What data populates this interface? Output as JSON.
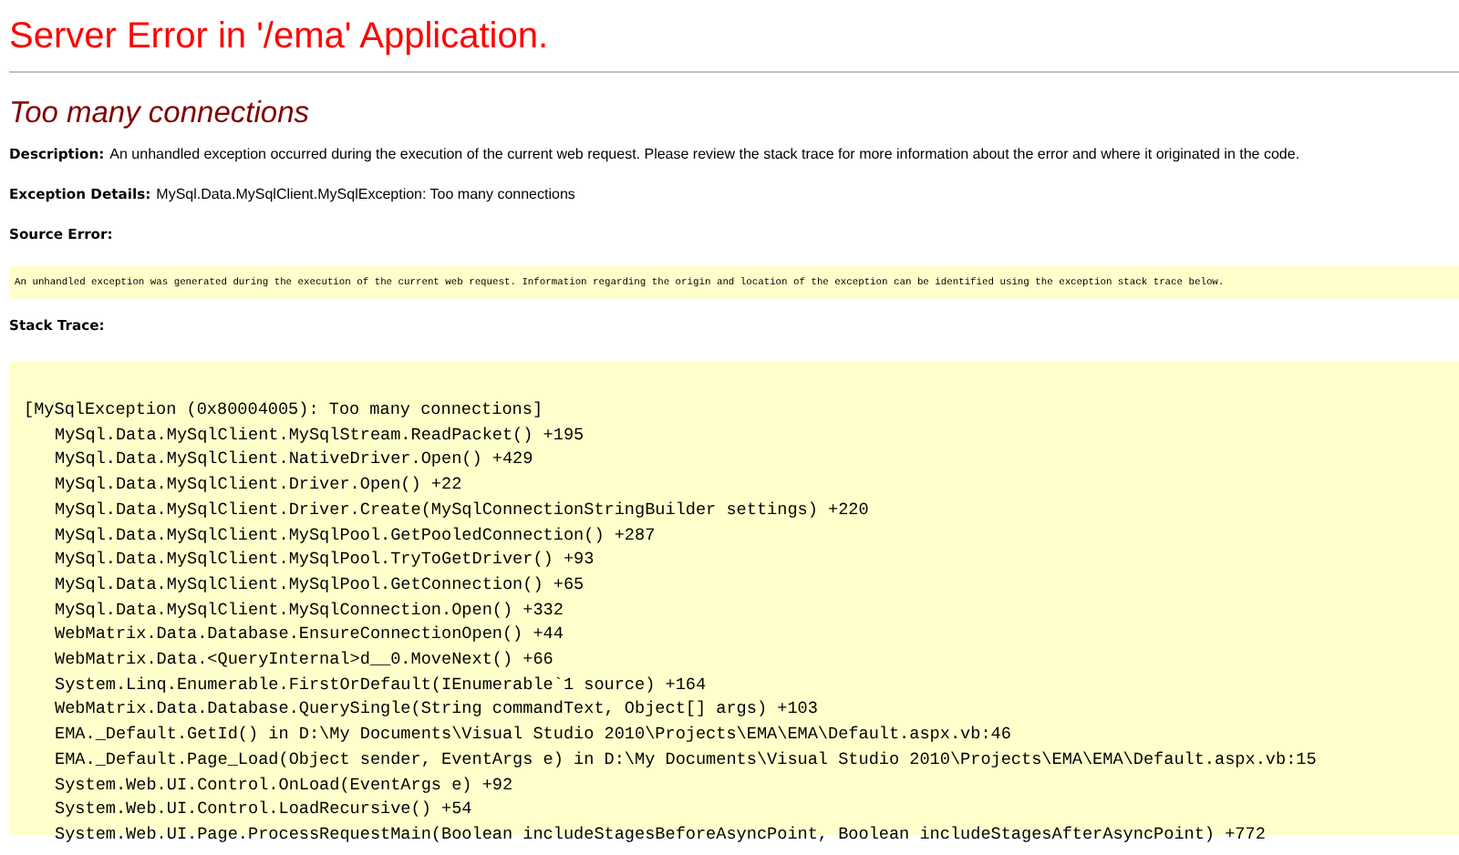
{
  "title": "Server Error in '/ema' Application.",
  "error_message": "Too many connections",
  "description": {
    "label": "Description:",
    "text": "An unhandled exception occurred during the execution of the current web request. Please review the stack trace for more information about the error and where it originated in the code."
  },
  "exception_details": {
    "label": "Exception Details:",
    "text": "MySql.Data.MySqlClient.MySqlException: Too many connections"
  },
  "source_error": {
    "label": "Source Error:",
    "text": "An unhandled exception was generated during the execution of the current web request. Information regarding the origin and location of the exception can be identified using the exception stack trace below."
  },
  "stack_trace": {
    "label": "Stack Trace:",
    "exception": "[MySqlException (0x80004005): Too many connections]",
    "frames": [
      "MySql.Data.MySqlClient.MySqlStream.ReadPacket() +195",
      "MySql.Data.MySqlClient.NativeDriver.Open() +429",
      "MySql.Data.MySqlClient.Driver.Open() +22",
      "MySql.Data.MySqlClient.Driver.Create(MySqlConnectionStringBuilder settings) +220",
      "MySql.Data.MySqlClient.MySqlPool.GetPooledConnection() +287",
      "MySql.Data.MySqlClient.MySqlPool.TryToGetDriver() +93",
      "MySql.Data.MySqlClient.MySqlPool.GetConnection() +65",
      "MySql.Data.MySqlClient.MySqlConnection.Open() +332",
      "WebMatrix.Data.Database.EnsureConnectionOpen() +44",
      "WebMatrix.Data.<QueryInternal>d__0.MoveNext() +66",
      "System.Linq.Enumerable.FirstOrDefault(IEnumerable`1 source) +164",
      "WebMatrix.Data.Database.QuerySingle(String commandText, Object[] args) +103",
      "EMA._Default.GetId() in D:\\My Documents\\Visual Studio 2010\\Projects\\EMA\\EMA\\Default.aspx.vb:46",
      "EMA._Default.Page_Load(Object sender, EventArgs e) in D:\\My Documents\\Visual Studio 2010\\Projects\\EMA\\EMA\\Default.aspx.vb:15",
      "System.Web.UI.Control.OnLoad(EventArgs e) +92",
      "System.Web.UI.Control.LoadRecursive() +54",
      "System.Web.UI.Page.ProcessRequestMain(Boolean includeStagesBeforeAsyncPoint, Boolean includeStagesAfterAsyncPoint) +772"
    ]
  }
}
